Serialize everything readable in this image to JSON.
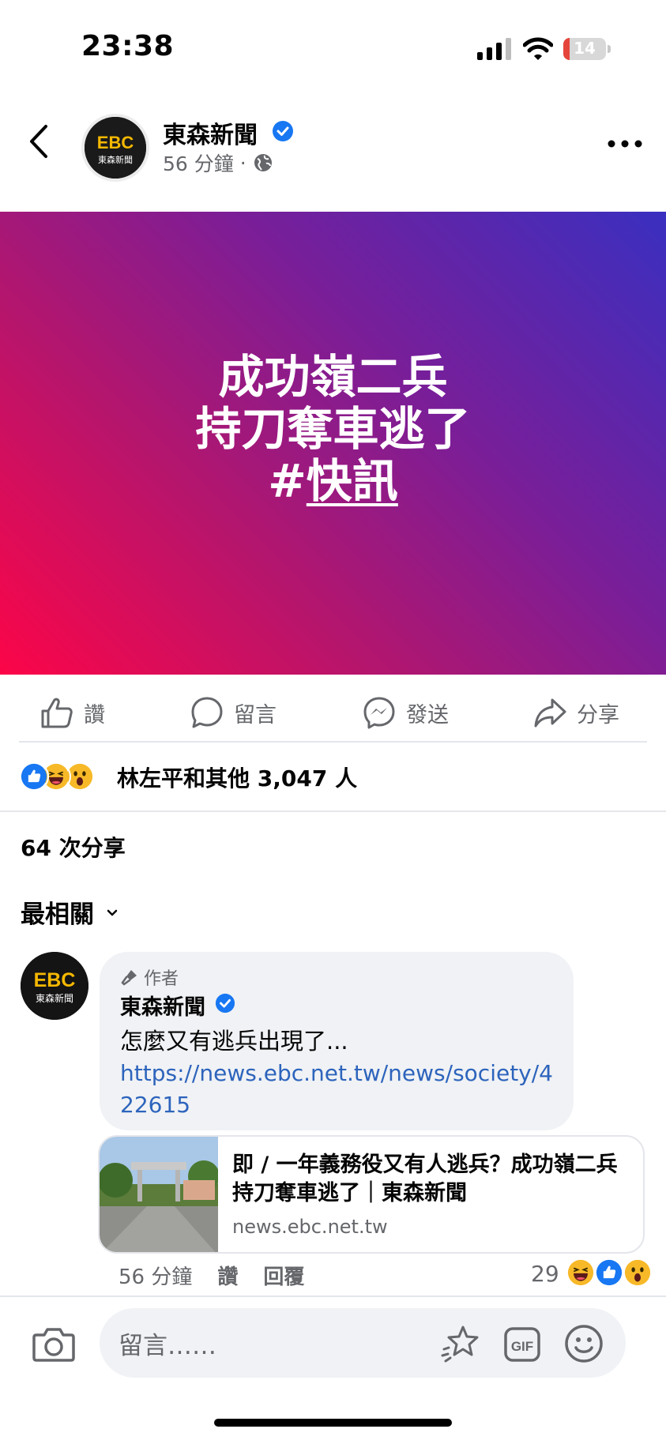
{
  "status": {
    "time": "23:38",
    "battery": "14",
    "battery_level": 0.14
  },
  "header": {
    "page_name": "東森新聞",
    "timestamp": "56 分鐘",
    "separator": "·",
    "logo_text": "EBC",
    "logo_sub": "東森新聞"
  },
  "banner": {
    "line1": "成功嶺二兵",
    "line2": "持刀奪車逃了",
    "hash": "#",
    "tag": "快訊",
    "colors": [
      "#fc0548",
      "#7a1e98",
      "#3a2fc0"
    ]
  },
  "actions": {
    "like": "讚",
    "comment": "留言",
    "send": "發送",
    "share": "分享"
  },
  "reactions": {
    "text": "林左平和其他 3,047 人",
    "icons": [
      "like-icon",
      "haha-icon",
      "wow-icon"
    ]
  },
  "shares": "64 次分享",
  "sort": {
    "label": "最相關"
  },
  "comment": {
    "author_tag": "作者",
    "name": "東森新聞",
    "text": "怎麼又有逃兵出現了...",
    "link": "https://news.ebc.net.tw/news/society/422615",
    "card_title": "即 / 一年義務役又有人逃兵？成功嶺二兵持刀奪車逃了｜東森新聞",
    "card_domain": "news.ebc.net.tw",
    "time": "56 分鐘",
    "like": "讚",
    "reply": "回覆",
    "reaction_count": "29"
  },
  "composer": {
    "placeholder": "留言……",
    "gif": "GIF"
  }
}
